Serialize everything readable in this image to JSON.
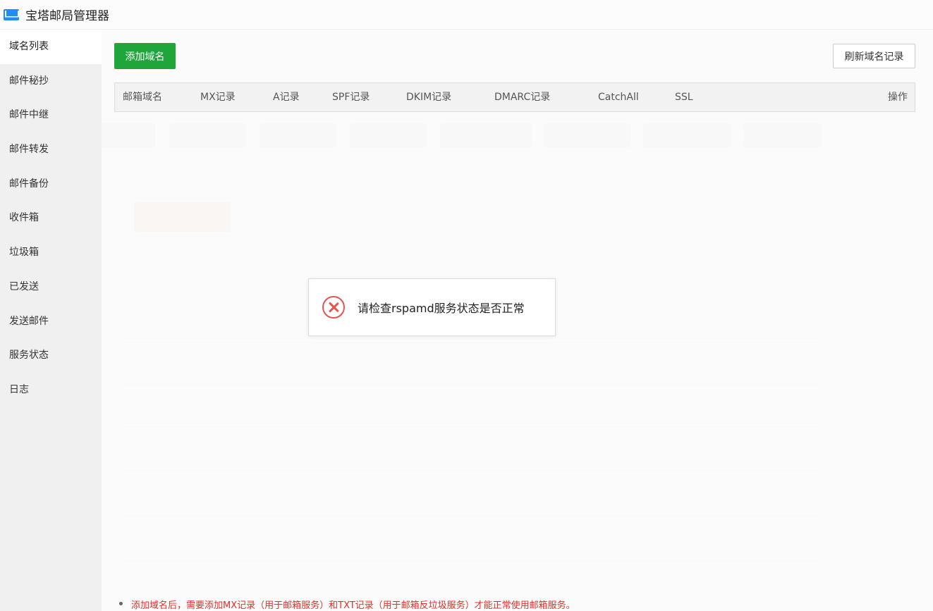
{
  "window": {
    "title": "宝塔邮局管理器"
  },
  "sidebar": {
    "items": [
      {
        "label": "域名列表"
      },
      {
        "label": "邮件秘抄"
      },
      {
        "label": "邮件中继"
      },
      {
        "label": "邮件转发"
      },
      {
        "label": "邮件备份"
      },
      {
        "label": "收件箱"
      },
      {
        "label": "垃圾箱"
      },
      {
        "label": "已发送"
      },
      {
        "label": "发送邮件"
      },
      {
        "label": "服务状态"
      },
      {
        "label": "日志"
      }
    ]
  },
  "toolbar": {
    "add_label": "添加域名",
    "refresh_label": "刷新域名记录"
  },
  "table": {
    "columns": [
      "邮箱域名",
      "MX记录",
      "A记录",
      "SPF记录",
      "DKIM记录",
      "DMARC记录",
      "CatchAll",
      "SSL",
      "操作"
    ]
  },
  "footer": {
    "note": "添加域名后，需要添加MX记录（用于邮箱服务）和TXT记录（用于邮箱反垃圾服务）才能正常使用邮箱服务。"
  },
  "toast": {
    "message": "请检查rspamd服务状态是否正常"
  },
  "colors": {
    "primary_green": "#20a53a",
    "error_red": "#e5554e",
    "note_red": "#e0302b"
  }
}
